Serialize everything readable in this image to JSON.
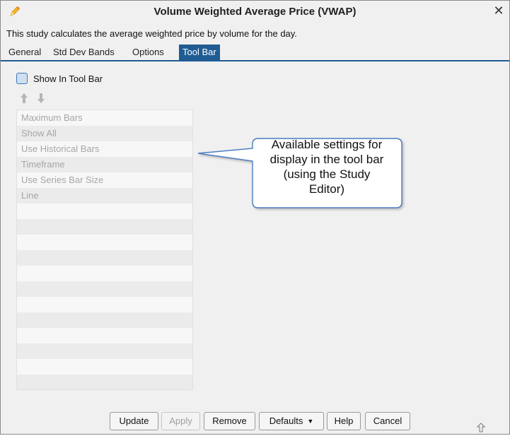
{
  "window": {
    "title": "Volume Weighted Average Price (VWAP)",
    "close_glyph": "✕"
  },
  "description": "This study calculates the average weighted price by volume for the day.",
  "tabs": [
    {
      "label": "General",
      "active": false
    },
    {
      "label": "Std Dev Bands",
      "active": false
    },
    {
      "label": "Options",
      "active": false
    },
    {
      "label": "Tool Bar",
      "active": true
    }
  ],
  "toolbar_panel": {
    "show_in_toolbar_label": "Show In Tool Bar",
    "show_in_toolbar_checked": false,
    "items": [
      "Maximum Bars",
      "Show All",
      "Use Historical Bars",
      "Timeframe",
      "Use Series Bar Size",
      "Line"
    ]
  },
  "callout": {
    "lines": [
      "Available settings for",
      "display in the tool bar",
      "(using the Study",
      "Editor)"
    ]
  },
  "buttons": {
    "update": "Update",
    "apply": "Apply",
    "remove": "Remove",
    "defaults": "Defaults",
    "help": "Help",
    "cancel": "Cancel"
  },
  "colors": {
    "accent": "#1f5c93",
    "callout_border": "#4a7cc0"
  },
  "icons": {
    "title": "pencil-icon",
    "close": "close-icon",
    "move_up": "arrow-up-icon",
    "move_down": "arrow-down-icon",
    "resize": "resize-grip-icon"
  }
}
